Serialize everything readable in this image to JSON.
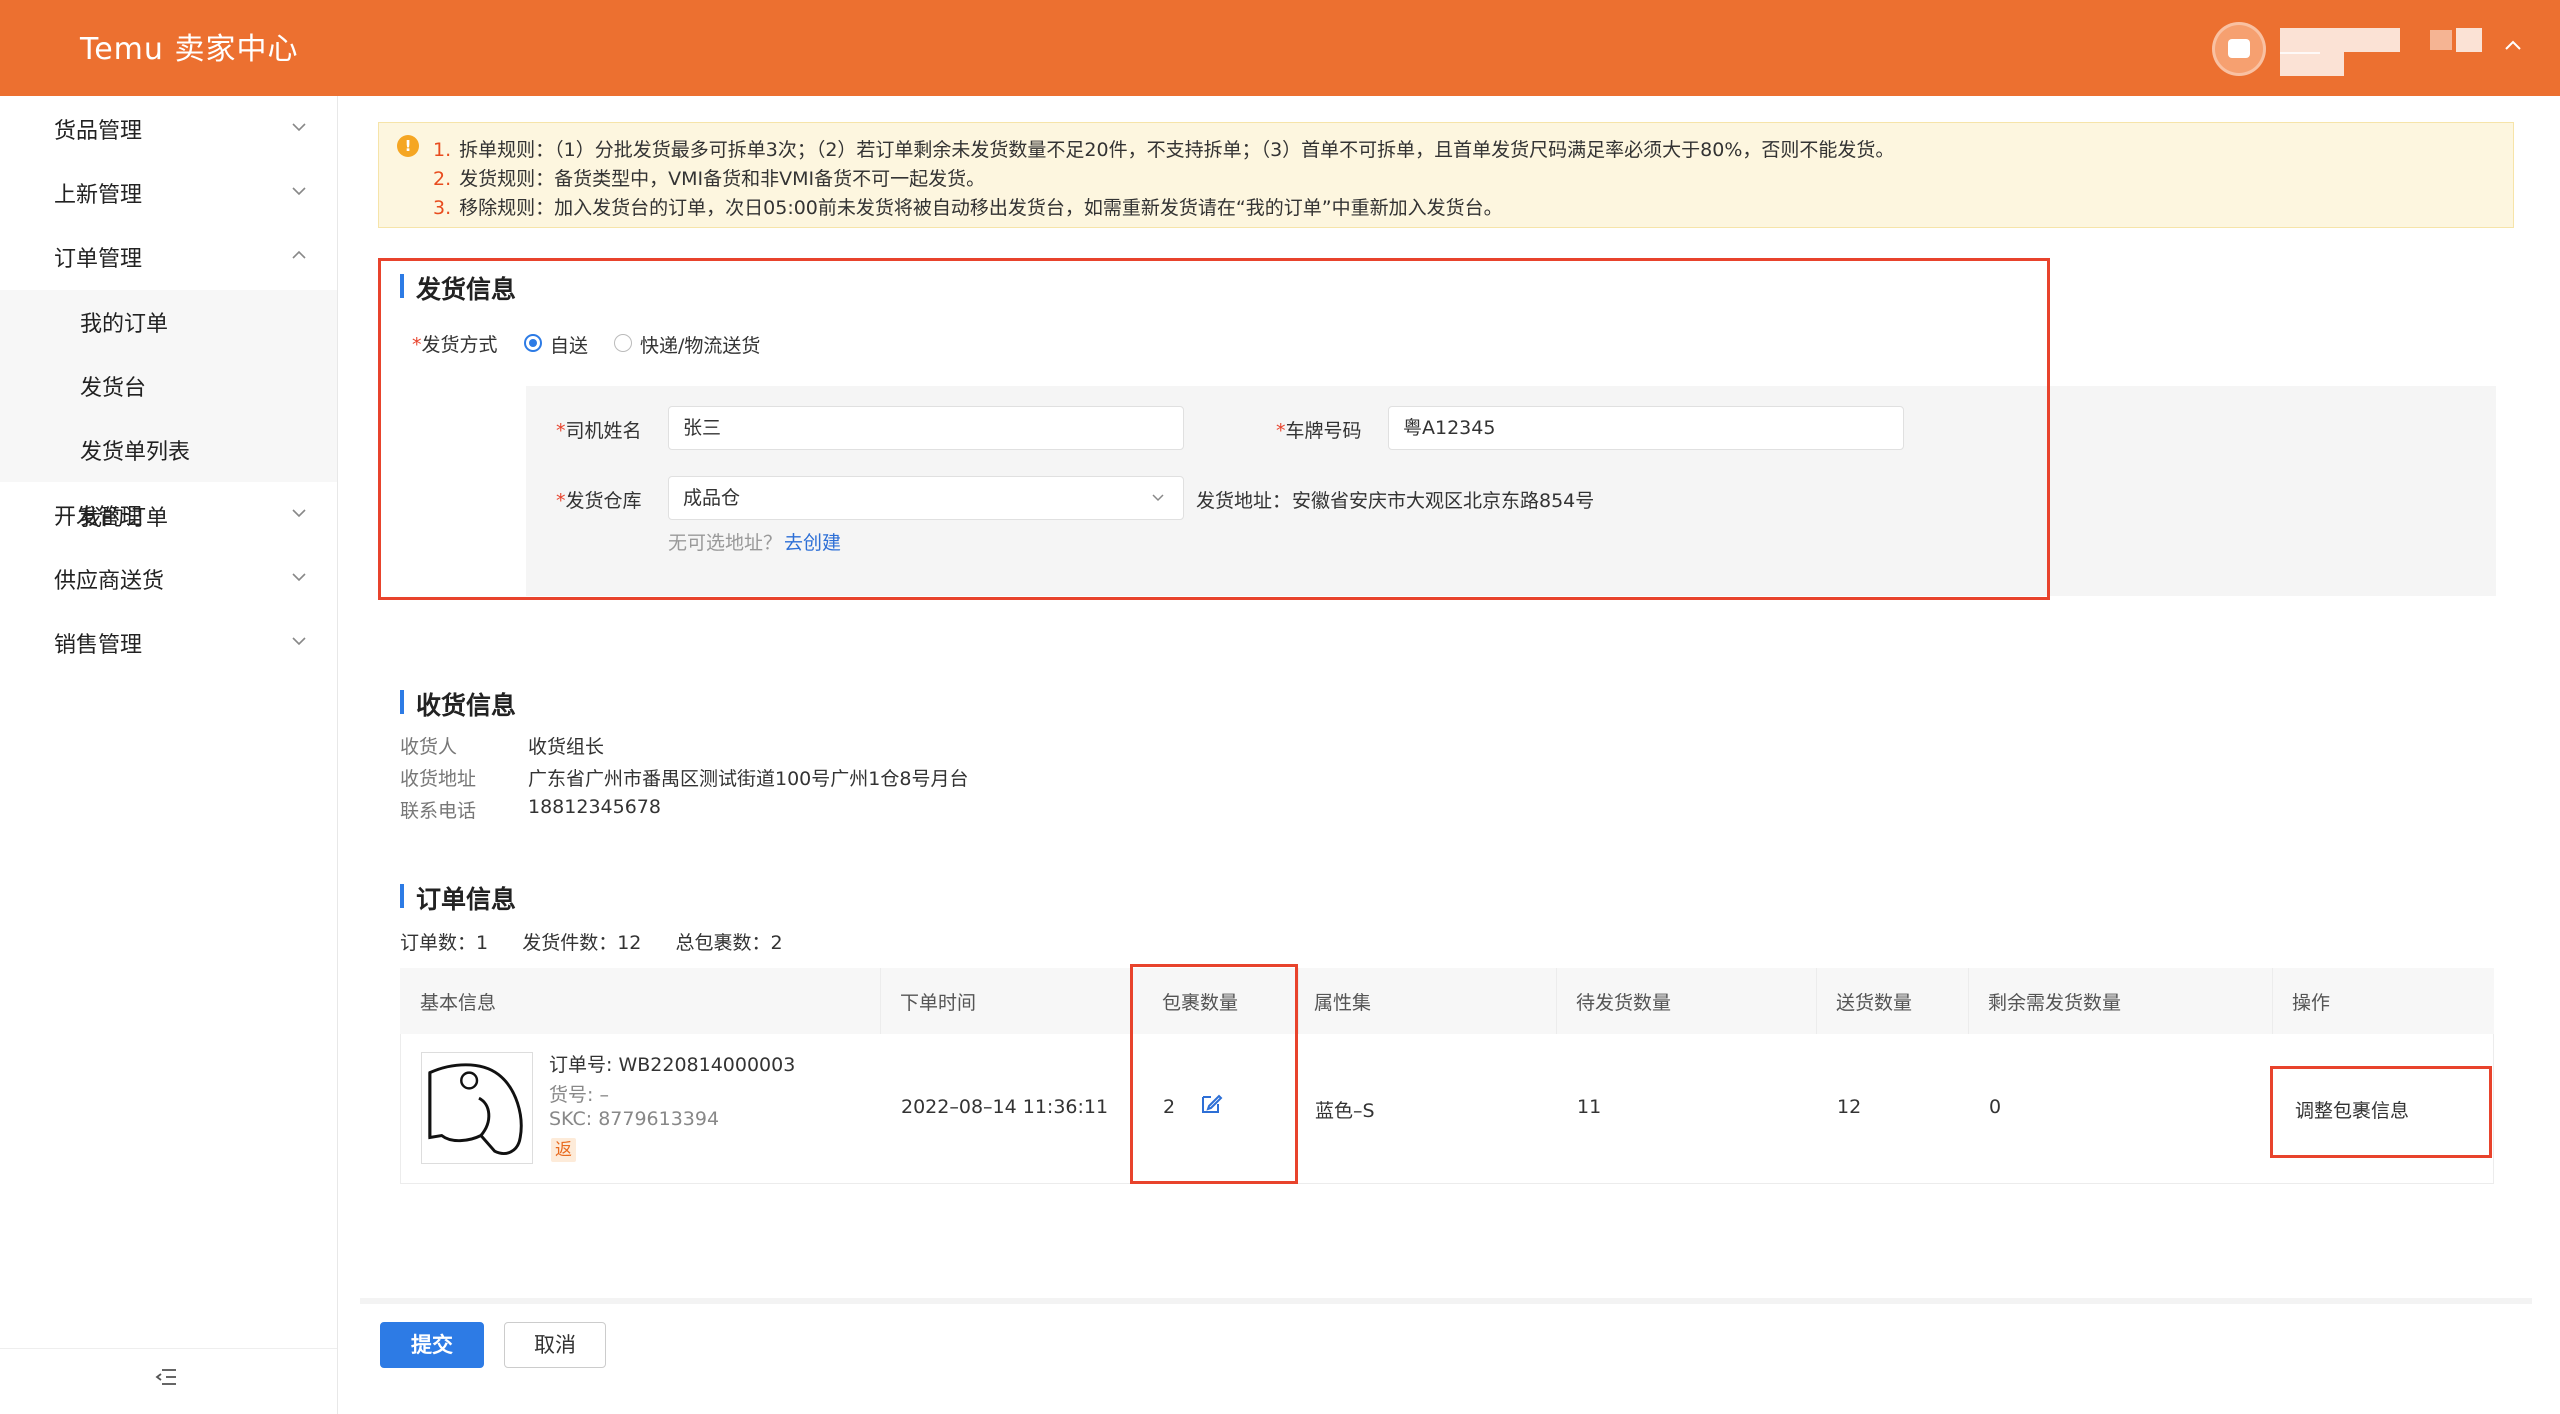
{
  "app": {
    "title": "Temu 卖家中心"
  },
  "sidebar": {
    "items": [
      {
        "label": "货品管理"
      },
      {
        "label": "上新管理"
      },
      {
        "label": "订单管理"
      },
      {
        "label": "开发管理"
      },
      {
        "label": "供应商送货"
      },
      {
        "label": "销售管理"
      }
    ],
    "subitems": [
      {
        "label": "我的订单"
      },
      {
        "label": "发货台"
      },
      {
        "label": "发货单列表"
      }
    ]
  },
  "notice": {
    "lines": [
      {
        "num": "1.",
        "text": "拆单规则：（1）分批发货最多可拆单3次；（2）若订单剩余未发货数量不足20件，不支持拆单；（3）首单不可拆单，且首单发货尺码满足率必须大于80%，否则不能发货。"
      },
      {
        "num": "2.",
        "text": "发货规则：备货类型中，VMI备货和非VMI备货不可一起发货。"
      },
      {
        "num": "3.",
        "text": "移除规则：加入发货台的订单，次日05:00前未发货将被自动移出发货台，如需重新发货请在“我的订单”中重新加入发货台。"
      }
    ]
  },
  "shipping": {
    "title": "发货信息",
    "method_label": "发货方式",
    "options": [
      "自送",
      "快递/物流送货"
    ],
    "driver_label": "司机姓名",
    "driver_value": "张三",
    "plate_label": "车牌号码",
    "plate_value": "粤A12345",
    "warehouse_label": "发货仓库",
    "warehouse_value": "成品仓",
    "address_label": "发货地址：",
    "address_value": "安徽省安庆市大观区北京东路854号",
    "no_address_hint": "无可选地址？",
    "create_link": "去创建"
  },
  "receiving": {
    "title": "收货信息",
    "receiver_label": "收货人",
    "receiver_value": "收货组长",
    "address_label": "收货地址",
    "address_value": "广东省广州市番禺区测试街道100号广州1仓8号月台",
    "phone_label": "联系电话",
    "phone_value": "18812345678"
  },
  "order": {
    "title": "订单信息",
    "summary": {
      "order_count_label": "订单数：",
      "order_count": "1",
      "ship_qty_label": "发货件数：",
      "ship_qty": "12",
      "package_label": "总包裹数：",
      "package_count": "2"
    },
    "columns": [
      "基本信息",
      "下单时间",
      "包裹数量",
      "属性集",
      "待发货数量",
      "送货数量",
      "剩余需发货数量",
      "操作"
    ],
    "row": {
      "order_no": "订单号: WB220814000003",
      "item_no": "货号: –",
      "skc": "SKC: 8779613394",
      "tag": "返",
      "time": "2022–08–14 11:36:11",
      "packages": "2",
      "attr": "蓝色–S",
      "pending": "11",
      "delivered": "12",
      "remaining": "0",
      "action": "调整包裹信息"
    }
  },
  "footer": {
    "submit": "提交",
    "cancel": "取消"
  },
  "colors": {
    "brand": "#EC7030",
    "primary": "#2D7BE5",
    "highlight": "#E8432C"
  }
}
